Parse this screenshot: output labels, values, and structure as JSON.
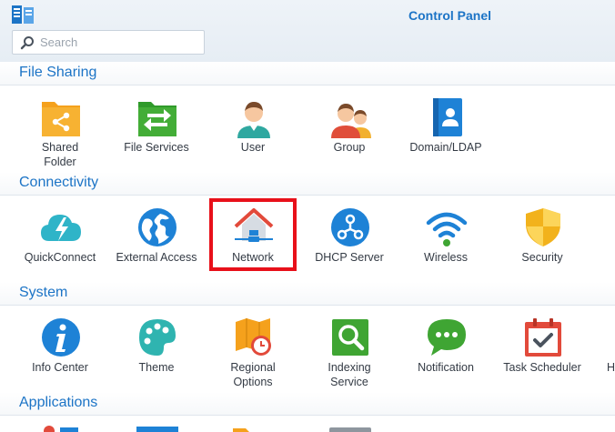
{
  "window": {
    "title": "Control Panel"
  },
  "search": {
    "placeholder": "Search",
    "value": ""
  },
  "sections": {
    "file_sharing": {
      "title": "File Sharing",
      "items": [
        {
          "label": "Shared\nFolder",
          "icon": "shared-folder-icon"
        },
        {
          "label": "File Services",
          "icon": "file-services-icon"
        },
        {
          "label": "User",
          "icon": "user-icon"
        },
        {
          "label": "Group",
          "icon": "group-icon"
        },
        {
          "label": "Domain/LDAP",
          "icon": "domain-ldap-icon"
        }
      ]
    },
    "connectivity": {
      "title": "Connectivity",
      "items": [
        {
          "label": "QuickConnect",
          "icon": "quickconnect-icon"
        },
        {
          "label": "External Access",
          "icon": "external-access-icon"
        },
        {
          "label": "Network",
          "icon": "network-icon"
        },
        {
          "label": "DHCP Server",
          "icon": "dhcp-server-icon"
        },
        {
          "label": "Wireless",
          "icon": "wireless-icon"
        },
        {
          "label": "Security",
          "icon": "security-icon"
        }
      ]
    },
    "system": {
      "title": "System",
      "items": [
        {
          "label": "Info Center",
          "icon": "info-center-icon"
        },
        {
          "label": "Theme",
          "icon": "theme-icon"
        },
        {
          "label": "Regional\nOptions",
          "icon": "regional-options-icon"
        },
        {
          "label": "Indexing\nService",
          "icon": "indexing-service-icon"
        },
        {
          "label": "Notification",
          "icon": "notification-icon"
        },
        {
          "label": "Task Scheduler",
          "icon": "task-scheduler-icon"
        },
        {
          "label": "H",
          "icon": "truncated-item-icon"
        }
      ]
    },
    "applications": {
      "title": "Applications"
    }
  },
  "colors": {
    "accent": "#1c74c6",
    "highlight": "#e8101a",
    "orange": "#f5a11c",
    "green": "#3fa533",
    "blue": "#1e82d6"
  }
}
